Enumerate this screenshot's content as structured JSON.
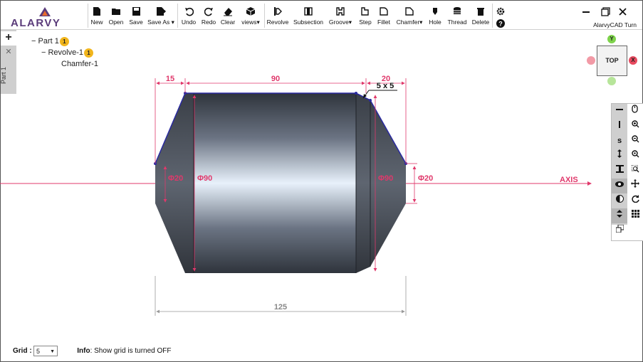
{
  "app": {
    "logo": "ALARVY",
    "window_title": "AlarvyCAD Turn"
  },
  "toolbar": {
    "file": [
      {
        "label": "New",
        "icon": "file-icon"
      },
      {
        "label": "Open",
        "icon": "folder-open-icon"
      },
      {
        "label": "Save",
        "icon": "save-icon"
      },
      {
        "label": "Save As",
        "icon": "save-as-icon"
      }
    ],
    "edit": [
      {
        "label": "Undo",
        "icon": "undo-icon"
      },
      {
        "label": "Redo",
        "icon": "redo-icon"
      },
      {
        "label": "Clear",
        "icon": "eraser-icon"
      },
      {
        "label": "views",
        "icon": "cube-icon"
      }
    ],
    "features": [
      {
        "label": "Revolve",
        "icon": "revolve-icon"
      },
      {
        "label": "Subsection",
        "icon": "subsection-icon"
      },
      {
        "label": "Groove",
        "icon": "groove-icon"
      },
      {
        "label": "Step",
        "icon": "step-icon"
      },
      {
        "label": "Fillet",
        "icon": "fillet-icon"
      },
      {
        "label": "Chamfer",
        "icon": "chamfer-icon"
      },
      {
        "label": "Hole",
        "icon": "hole-icon"
      },
      {
        "label": "Thread",
        "icon": "thread-icon"
      },
      {
        "label": "Delete",
        "icon": "trash-icon"
      }
    ]
  },
  "left_tab": {
    "add": "+",
    "close": "✕",
    "tab_label": "Part 1"
  },
  "tree": {
    "part": {
      "label": "Part 1",
      "badge": "1"
    },
    "revolve": {
      "label": "Revolve-1",
      "badge": "1"
    },
    "chamfer": {
      "label": "Chamfer-1"
    }
  },
  "viewcube": {
    "face": "TOP",
    "y": "Y",
    "x": "X"
  },
  "drawing": {
    "dim_left_len": "15",
    "dim_mid_len": "90",
    "dim_right_len": "20",
    "chamfer_label": "5 x 5",
    "dia_left_small": "Φ20",
    "dia_left_big": "Φ90",
    "dia_right_big": "Φ90",
    "dia_right_small": "Φ20",
    "axis_label": "AXIS",
    "total_len": "125"
  },
  "footer": {
    "grid_label": "Grid :",
    "grid_value": "5",
    "info_label": "Info",
    "info_text": ": Show grid is turned OFF"
  }
}
